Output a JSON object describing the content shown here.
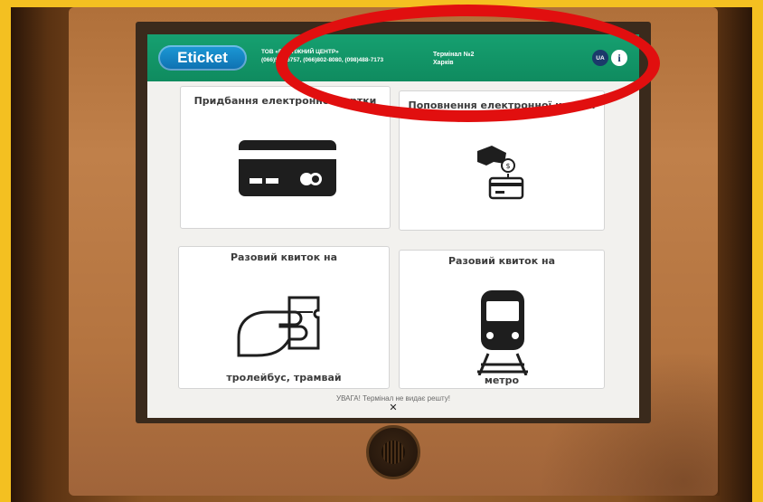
{
  "header": {
    "logo_text": "Eticket",
    "org_line1": "ТОВ «ПЛАТІЖНИЙ ЦЕНТР»",
    "org_line2": "(066)553-6757, (066)802-8080, (098)488-7173",
    "terminal_line1": "Термінал №2",
    "terminal_line2": "Харків",
    "lang_label": "UA",
    "info_label": "i",
    "accent_color": "#0f8b5f",
    "logo_color": "#1786c8"
  },
  "tiles": [
    {
      "title": "Придбання електронної картки",
      "icon": "credit-card-icon"
    },
    {
      "title": "Поповнення електронної картки",
      "icon": "hand-coin-card-icon"
    },
    {
      "title": "Разовий квиток на",
      "subtitle": "тролейбус, трамвай",
      "icon": "hand-ticket-icon"
    },
    {
      "title": "Разовий квиток на",
      "subtitle": "метро",
      "icon": "metro-train-icon"
    }
  ],
  "footer": {
    "warning": "УВАГА! Термінал не видає решту!",
    "close_label": "✕"
  },
  "annotation": {
    "ring_color": "#e10f0f"
  }
}
